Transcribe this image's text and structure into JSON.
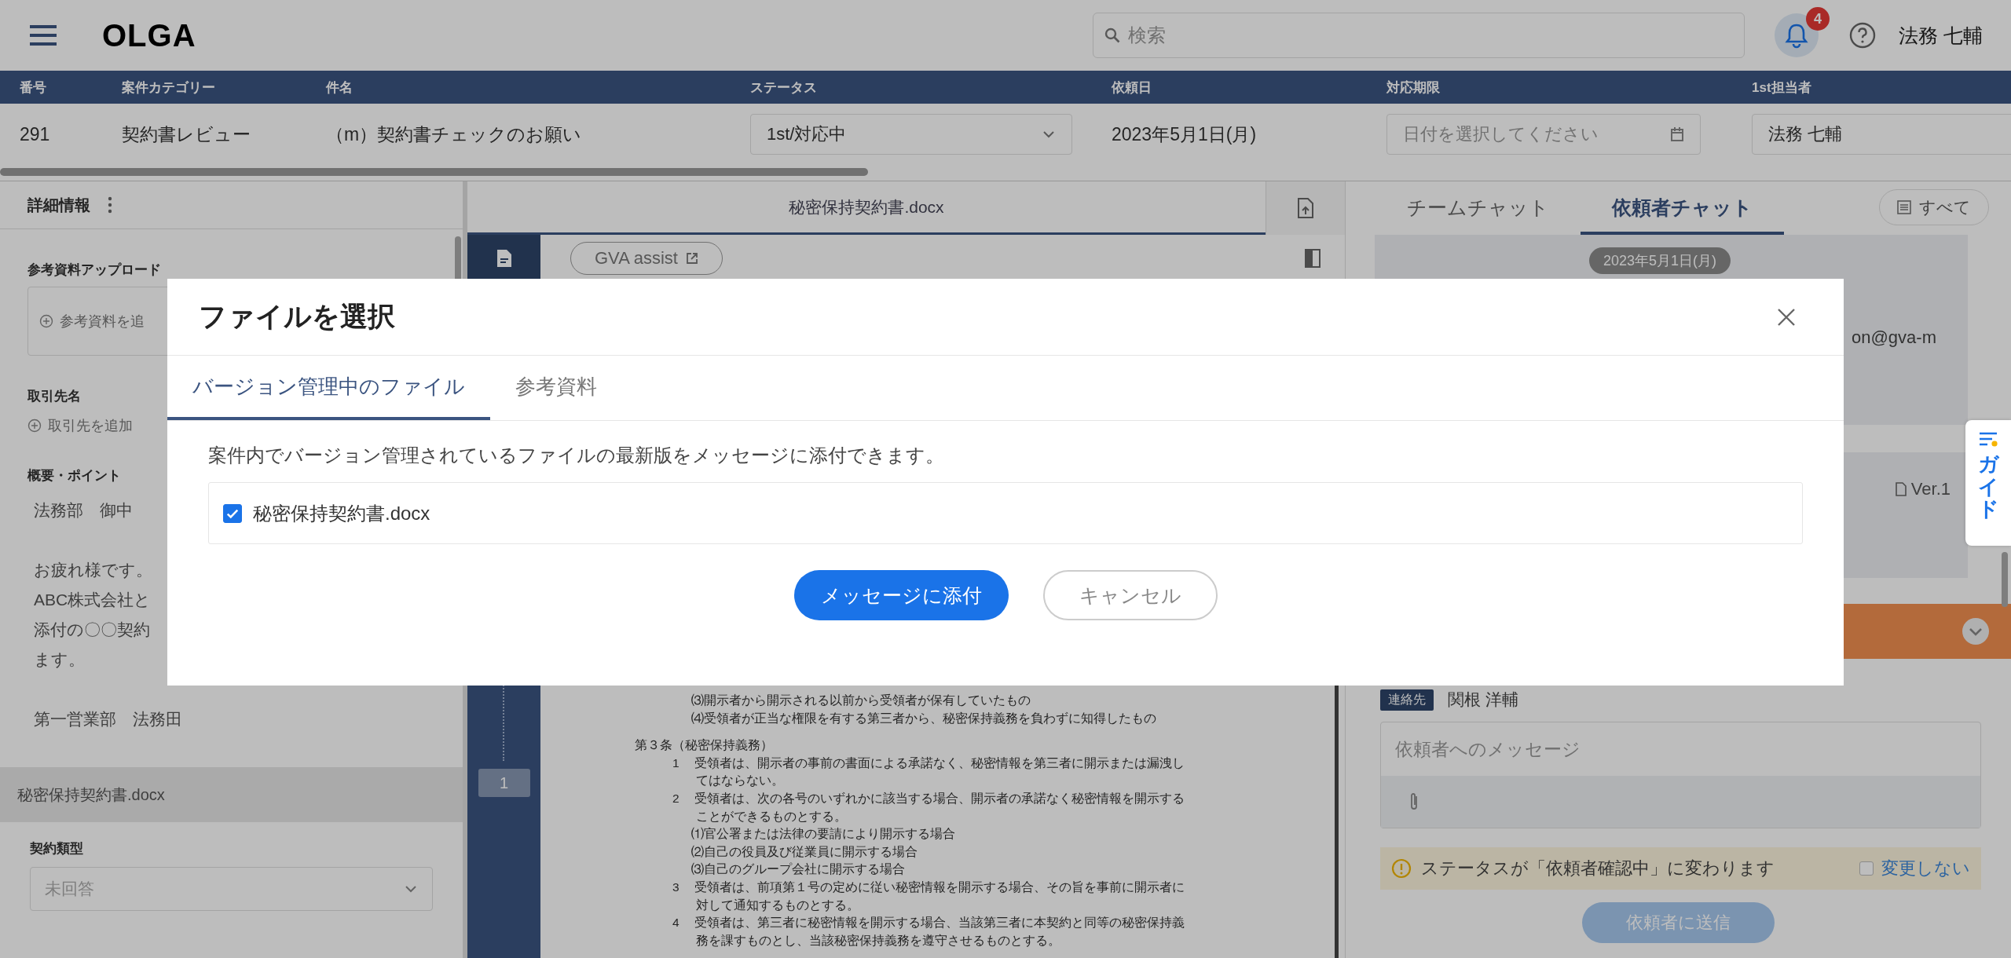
{
  "header": {
    "logo": "OLGA",
    "search": {
      "placeholder": "検索"
    },
    "notification_count": "4",
    "user_name": "法務 七輔"
  },
  "case_table": {
    "columns": [
      "番号",
      "案件カテゴリー",
      "件名",
      "ステータス",
      "依頼日",
      "対応期限",
      "1st担当者"
    ],
    "row": {
      "number": "291",
      "category": "契約書レビュー",
      "subject": "（m）契約書チェックのお願い",
      "status": "1st/対応中",
      "request_date": "2023年5月1日(月)",
      "deadline": {
        "placeholder": "日付を選択してください"
      },
      "assignee": "法務 七輔"
    }
  },
  "details_panel": {
    "title": "詳細情報",
    "upload": {
      "label": "参考資料アップロード",
      "button": "参考資料を追"
    },
    "client": {
      "label": "取引先名",
      "button": "取引先を追加"
    },
    "summary": {
      "label": "概要・ポイント",
      "paragraphs": [
        [
          "法務部　御中"
        ],
        [
          "お疲れ様です。",
          "ABC株式会社と",
          "添付の〇〇契約",
          "ます。"
        ],
        [
          "第一営業部　法務田"
        ]
      ]
    },
    "file": {
      "name": "秘密保持契約書.docx",
      "contract_type": {
        "label": "契約類型",
        "placeholder": "未回答"
      }
    }
  },
  "document": {
    "file_name": "秘密保持契約書.docx",
    "assist_button": "GVA assist",
    "page_number": "1",
    "lines": [
      {
        "kind": "sub",
        "text": "⑶開示者から開示される以前から受領者が保有していたもの"
      },
      {
        "kind": "sub",
        "text": "⑷受領者が正当な権限を有する第三者から、秘密保持義務を負わずに知得したもの"
      },
      {
        "kind": "heading",
        "text": "第３条（秘密保持義務）"
      },
      {
        "kind": "numbered",
        "number": "1",
        "text": "受領者は、開示者の事前の書面による承諾なく、秘密情報を第三者に開示または漏洩し"
      },
      {
        "kind": "wrap",
        "text": "てはならない。"
      },
      {
        "kind": "numbered",
        "number": "2",
        "text": "受領者は、次の各号のいずれかに該当する場合、開示者の承諾なく秘密情報を開示する"
      },
      {
        "kind": "wrap",
        "text": "ことができるものとする。"
      },
      {
        "kind": "sub",
        "text": "⑴官公署または法律の要請により開示する場合"
      },
      {
        "kind": "sub",
        "text": "⑵自己の役員及び従業員に開示する場合"
      },
      {
        "kind": "sub",
        "text": "⑶自己のグループ会社に開示する場合"
      },
      {
        "kind": "numbered",
        "number": "3",
        "text": "受領者は、前項第１号の定めに従い秘密情報を開示する場合、その旨を事前に開示者に"
      },
      {
        "kind": "wrap",
        "text": "対して通知するものとする。"
      },
      {
        "kind": "numbered",
        "number": "4",
        "text": "受領者は、第三者に秘密情報を開示する場合、当該第三者に本契約と同等の秘密保持義"
      },
      {
        "kind": "wrap",
        "text": "務を課すものとし、当該秘密保持義務を遵守させるものとする。"
      }
    ]
  },
  "chat_panel": {
    "tabs": [
      {
        "label": "チームチャット",
        "selected": false
      },
      {
        "label": "依頼者チャット",
        "selected": true
      }
    ],
    "filter_button": "すべて",
    "date": "2023年5月1日(月)",
    "email_fragment": "on@gva-m",
    "file_version": "Ver.1",
    "recipient": {
      "tag": "連絡先",
      "name": "関根 洋輔"
    },
    "message": {
      "placeholder": "依頼者へのメッセージ"
    },
    "status_notice": {
      "text": "ステータスが「依頼者確認中」に変わります",
      "option": {
        "label": "変更しない",
        "checked": false
      }
    },
    "send_button": {
      "label": "依頼者に送信",
      "disabled": true
    }
  },
  "guide_tab": {
    "label": "ガイド"
  },
  "modal": {
    "title": "ファイルを選択",
    "tabs": [
      {
        "label": "バージョン管理中のファイル",
        "selected": true
      },
      {
        "label": "参考資料",
        "selected": false
      }
    ],
    "description": "案件内でバージョン管理されているファイルの最新版をメッセージに添付できます。",
    "files": [
      {
        "name": "秘密保持契約書.docx",
        "checked": true
      }
    ],
    "buttons": [
      {
        "label": "メッセージに添付",
        "kind": "primary"
      },
      {
        "label": "キャンセル",
        "kind": "secondary"
      }
    ]
  }
}
